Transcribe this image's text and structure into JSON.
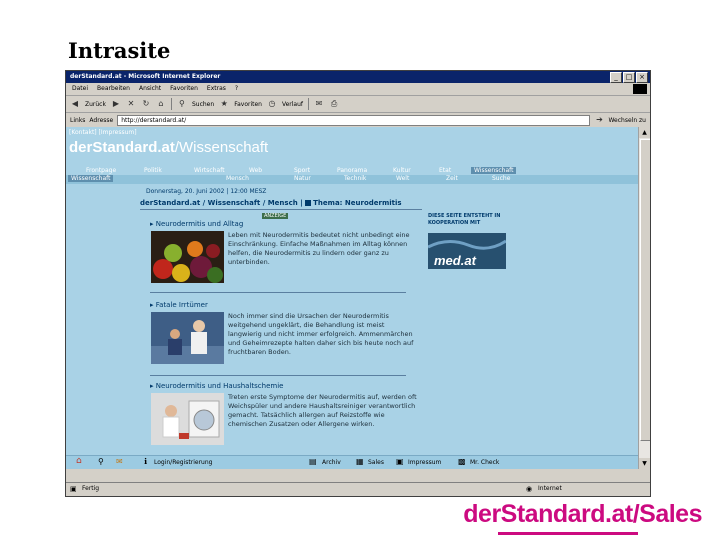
{
  "slide": {
    "title": "Intrasite",
    "brand": "derStandard.at/Sales"
  },
  "browser": {
    "title": "derStandard.at - Microsoft Internet Explorer",
    "window_buttons": [
      "_",
      "□",
      "×"
    ],
    "menu": [
      "Datei",
      "Bearbeiten",
      "Ansicht",
      "Favoriten",
      "Extras",
      "?"
    ],
    "toolbar": [
      "Zurück",
      "Suchen",
      "Favoriten",
      "Verlauf"
    ],
    "address_label": "Adresse",
    "links_label": "Links",
    "address_value": "http://derstandard.at/",
    "go_label": "Wechseln zu",
    "status_left": "Fertig",
    "status_right": "Internet"
  },
  "site": {
    "top_links": "[Kontakt] [Impressum]",
    "logo_main": "derStandard.at",
    "logo_section": "/Wissenschaft",
    "nav_primary": [
      "Frontpage",
      "Politik",
      "Wirtschaft",
      "Web",
      "Sport",
      "Panorama",
      "Kultur",
      "Etat",
      "Wissenschaft"
    ],
    "nav_secondary": [
      "Wissenschaft",
      "Mensch",
      "Natur",
      "Technik",
      "Welt",
      "Zeit",
      "Suche"
    ],
    "date_line": "Donnerstag, 20. Juni 2002 | 12:00 MESZ",
    "breadcrumb": [
      "derStandard.at",
      "Wissenschaft",
      "Mensch",
      "Thema: Neurodermitis"
    ],
    "badge": "ANZEIGE",
    "partner_label": "DIESE SEITE ENTSTEHT IN KOOPERATION MIT",
    "partner_logo": "med.at",
    "articles": [
      {
        "title": "Neurodermitis und Alltag",
        "text": "Leben mit Neurodermitis bedeutet nicht unbedingt eine Einschränkung. Einfache Maßnahmen im Alltag können helfen, die Neurodermitis zu lindern oder ganz zu unterbinden."
      },
      {
        "title": "Fatale Irrtümer",
        "text": "Noch immer sind die Ursachen der Neurodermitis weitgehend ungeklärt, die Behandlung ist meist langwierig und nicht immer erfolgreich. Ammenmärchen und Geheimrezepte halten daher sich bis heute noch auf fruchtbaren Boden."
      },
      {
        "title": "Neurodermitis und Haushaltschemie",
        "text": "Treten erste Symptome der Neurodermitis auf, werden oft Weichspüler und andere Haushaltsreiniger verantwortlich gemacht. Tatsächlich allergen auf Reizstoffe wie chemischen Zusatzen oder Allergene wirken."
      }
    ],
    "footer": [
      "Login/Registrierung",
      "Archiv",
      "Sales",
      "Impressum",
      "Mr. Check"
    ]
  }
}
